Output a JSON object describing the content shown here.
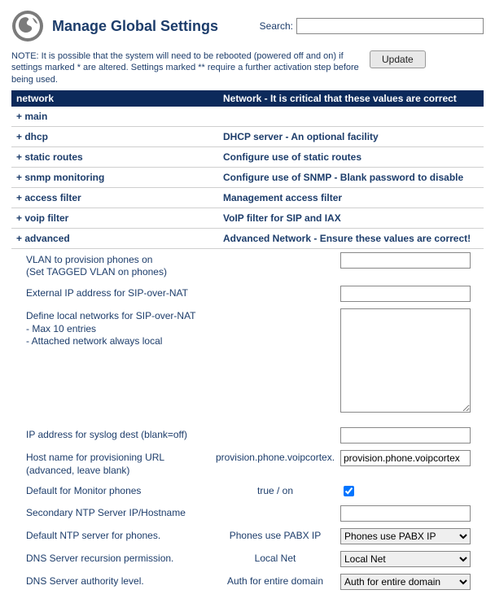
{
  "header": {
    "title": "Manage Global Settings",
    "search_label": "Search:",
    "search_value": ""
  },
  "note": "NOTE: It is possible that the system will need to be rebooted (powered off and on) if settings marked * are altered. Settings marked ** require a further activation step before being used.",
  "update_label": "Update",
  "category_header": {
    "left": "network",
    "right": "Network - It is critical that these values are correct"
  },
  "sections": [
    {
      "id": "main",
      "label": "+ main",
      "desc": ""
    },
    {
      "id": "dhcp",
      "label": "+ dhcp",
      "desc": "DHCP server - An optional facility"
    },
    {
      "id": "static-routes",
      "label": "+ static routes",
      "desc": "Configure use of static routes"
    },
    {
      "id": "snmp",
      "label": "+ snmp monitoring",
      "desc": "Configure use of SNMP - Blank password to disable"
    },
    {
      "id": "access-filter",
      "label": "+ access filter",
      "desc": "Management access filter"
    },
    {
      "id": "voip-filter",
      "label": "+ voip filter",
      "desc": "VoIP filter for SIP and IAX"
    },
    {
      "id": "advanced",
      "label": "+ advanced",
      "desc": "Advanced Network - Ensure these values are correct!"
    }
  ],
  "advanced": {
    "vlan": {
      "label": "VLAN to provision phones on\n(Set TAGGED VLAN on phones)",
      "hint": "",
      "value": ""
    },
    "ext_ip": {
      "label": "External IP address for SIP-over-NAT",
      "hint": "",
      "value": ""
    },
    "localnets": {
      "label": "Define local networks for SIP-over-NAT\n- Max 10 entries\n- Attached network always local",
      "hint": "",
      "value": ""
    },
    "syslog": {
      "label": "IP address for syslog dest (blank=off)",
      "hint": "",
      "value": ""
    },
    "prov_host": {
      "label": "Host name for provisioning URL\n(advanced, leave blank)",
      "hint": "provision.phone.voipcortex.",
      "value": "provision.phone.voipcortex"
    },
    "monitor_default": {
      "label": "Default for Monitor phones",
      "hint": "true / on",
      "checked": true
    },
    "sec_ntp": {
      "label": "Secondary NTP Server IP/Hostname",
      "hint": "",
      "value": ""
    },
    "def_ntp": {
      "label": "Default NTP server for phones.",
      "hint": "Phones use PABX IP",
      "value": "Phones use PABX IP"
    },
    "dns_recursion": {
      "label": "DNS Server recursion permission.",
      "hint": "Local Net",
      "value": "Local Net"
    },
    "dns_authority": {
      "label": "DNS Server authority level.",
      "hint": "Auth for entire domain",
      "value": "Auth for entire domain"
    }
  }
}
